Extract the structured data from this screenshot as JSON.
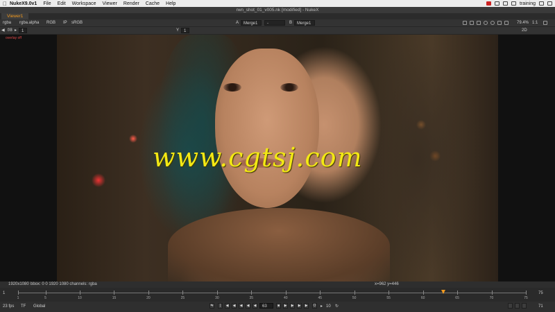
{
  "menubar": {
    "app": "NukeX9.0v1",
    "items": [
      "File",
      "Edit",
      "Workspace",
      "Viewer",
      "Render",
      "Cache",
      "Help"
    ],
    "user": "training"
  },
  "window": {
    "title": "rwn_shot_01_v005.nk [modified] - NukeX"
  },
  "viewer_tab": {
    "label": "Viewer1"
  },
  "toolbar1": {
    "channels": "rgba",
    "alpha": "rgba.alpha",
    "colorspace": "RGB",
    "ip": "IP",
    "lut": "sRGB",
    "input_a_label": "A",
    "input_a": "Merge1",
    "compare": "-",
    "input_b_label": "B",
    "input_b": "Merge1",
    "zoom": "79.4%",
    "ratio": "1:1"
  },
  "toolbar2": {
    "fstop": "f/8",
    "gain": "1",
    "y_label": "Y",
    "gamma": "1",
    "view_mode": "2D"
  },
  "viewer": {
    "overlay_label": "overlay off",
    "watermark": "www.cgtsj.com"
  },
  "infobar": {
    "format": "1920x1080",
    "bbox": "bbox: 0 0 1920 1080 channels: rgba",
    "coords": "x=962 y=446"
  },
  "timeline": {
    "start": "1",
    "end": "75",
    "labels": [
      "1",
      "5",
      "10",
      "15",
      "20",
      "25",
      "30",
      "35",
      "40",
      "45",
      "50",
      "55",
      "60",
      "65",
      "70",
      "75"
    ],
    "current_frame": 63
  },
  "controls": {
    "fps": "23 fps",
    "tf": "TF",
    "global": "Global",
    "frame": "63",
    "increment": "10",
    "end_frame": "71"
  },
  "colors": {
    "accent": "#f39a1e",
    "watermark": "#f3e814"
  }
}
